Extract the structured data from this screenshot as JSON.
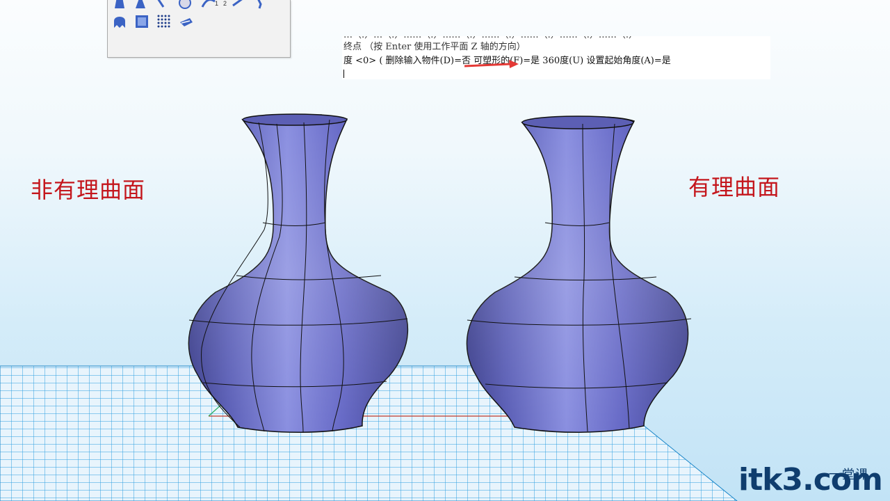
{
  "command_line": {
    "line0": "…（.）…（.）……（.）……（.）……（.）……（.）……（.）……（.）",
    "line1": "终点 （按 Enter 使用工作平面 Z 轴的方向）",
    "line2": "度 <0> ( 删除输入物件(D)=否  可塑形的(F)=是   360度(U)   设置起始角度(A)=是"
  },
  "labels": {
    "left": "非有理曲面",
    "right": "有理曲面"
  },
  "watermark": {
    "main": "itk3.com",
    "sub": "一堂课"
  },
  "toolbar": {
    "tools": [
      "surface-sweep-icon",
      "surface-extrude-icon",
      "revolve-icon",
      "sphere-icon",
      "curve-icon",
      "network-icon",
      "patch-icon",
      "planar-surface-icon",
      "point-grid-icon",
      "blend-surface-icon"
    ],
    "subscript_1": "1",
    "subscript_2": "2"
  },
  "colors": {
    "vase": "#6a6ec4",
    "grid": "#2b9ee0",
    "label_red": "#c4161c",
    "arrow_red": "#e53935"
  }
}
